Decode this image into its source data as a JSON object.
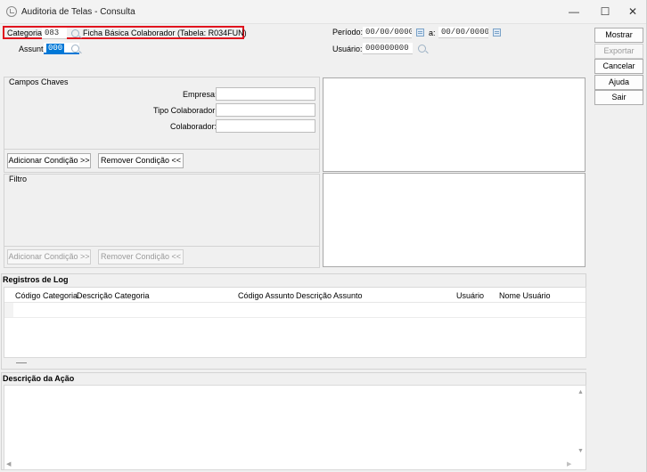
{
  "window": {
    "title": "Auditoria de Telas - Consulta",
    "minimize": "—",
    "maximize": "☐",
    "close": "✕"
  },
  "filters": {
    "categoria_label": "Categoria:",
    "categoria_value": "083",
    "categoria_desc": "Ficha Básica Colaborador (Tabela: R034FUN)",
    "assunto_label": "Assunto:",
    "assunto_value": "000",
    "periodo_label": "Período:",
    "periodo_from": "00/00/0000",
    "periodo_sep": "a:",
    "periodo_to": "00/00/0000",
    "usuario_label": "Usuário:",
    "usuario_value": "000000000"
  },
  "actions": {
    "mostrar": "Mostrar",
    "exportar": "Exportar",
    "cancelar": "Cancelar",
    "ajuda": "Ajuda",
    "sair": "Sair"
  },
  "campos_chaves": {
    "title": "Campos Chaves",
    "empresa_label": "Empresa:",
    "tipo_label": "Tipo Colaborador:",
    "colaborador_label": "Colaborador:",
    "add_button": "Adicionar Condição >>",
    "remove_button": "Remover Condição <<"
  },
  "filtro": {
    "title": "Filtro",
    "add_button": "Adicionar Condição >>",
    "remove_button": "Remover Condição <<"
  },
  "registros": {
    "title": "Registros de Log",
    "columns": [
      "Código Categoria",
      "Descrição Categoria",
      "Código Assunto",
      "Descrição Assunto",
      "Usuário",
      "Nome Usuário"
    ]
  },
  "descricao": {
    "title": "Descrição da Ação"
  },
  "icons": {
    "search": "magnifier-icon",
    "calendar": "calendar-icon",
    "scroll_up": "▲",
    "scroll_down": "▼",
    "scroll_left": "◀",
    "scroll_right": "▶"
  }
}
